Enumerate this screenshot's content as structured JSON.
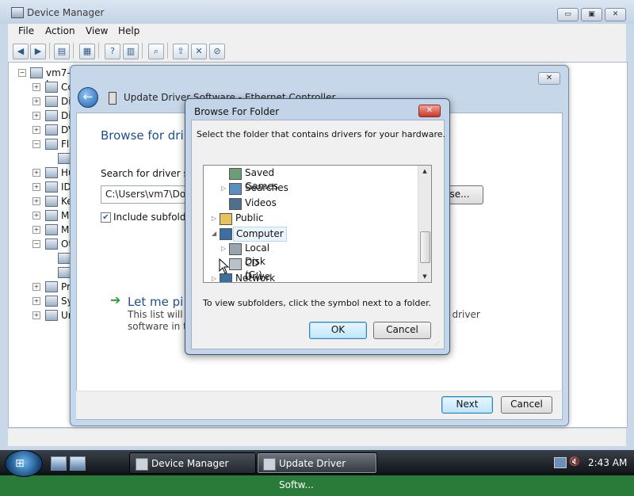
{
  "device_manager": {
    "title": "Device Manager",
    "menu": [
      "File",
      "Action",
      "View",
      "Help"
    ],
    "window_buttons": {
      "min": "▭",
      "max": "▣",
      "close": "✕"
    },
    "tree": {
      "root": "vm7-I",
      "items": [
        "Co",
        "Di",
        "Di",
        "DV",
        "Flo",
        "",
        "Hu",
        "ID",
        "Ke",
        "Mi",
        "Mo",
        "Ot",
        "",
        "",
        "Pr",
        "Sy",
        "Un"
      ]
    }
  },
  "wizard": {
    "title": "Update Driver Software - Ethernet Controller",
    "close": "✕",
    "heading": "Browse for dri",
    "search_label": "Search for driver so",
    "path_value": "C:\\Users\\vm7\\Do",
    "browse_label": "se...",
    "include_subfolders": "Include subfold",
    "pick_text": "Let me pi",
    "pick_desc_line1": "This list will s",
    "pick_desc_line2": "software in t",
    "pick_desc_right": "ll driver",
    "next_label": "Next",
    "cancel_label": "Cancel"
  },
  "browse_folder": {
    "title": "Browse For Folder",
    "instruction": "Select the folder that contains drivers for your hardware.",
    "tree": [
      {
        "label": "Saved Games",
        "icon": "saved-games-icon",
        "expander": ""
      },
      {
        "label": "Searches",
        "icon": "searches-icon",
        "expander": "▷"
      },
      {
        "label": "Videos",
        "icon": "videos-icon",
        "expander": ""
      },
      {
        "label": "Public",
        "icon": "folder-icon",
        "expander": "▷"
      },
      {
        "label": "Computer",
        "icon": "computer-icon",
        "expander": "◢"
      },
      {
        "label": "Local Disk (C:)",
        "icon": "local-disk-icon",
        "expander": "▷"
      },
      {
        "label": "CD Drive (D:) VistaLite",
        "icon": "cd-drive-icon",
        "expander": ""
      },
      {
        "label": "Network",
        "icon": "network-icon",
        "expander": "▷"
      }
    ],
    "hint": "To view subfolders, click the symbol next to a folder.",
    "ok_label": "OK",
    "cancel_label": "Cancel"
  },
  "taskbar": {
    "tasks": [
      "Device Manager",
      "Update Driver Softw..."
    ],
    "clock": "2:43 AM",
    "start_glyph": "⊞"
  },
  "colors": {
    "accent_blue": "#1f4f8f",
    "window_frame": "#c3d4e8",
    "close_red": "#c8382b"
  }
}
